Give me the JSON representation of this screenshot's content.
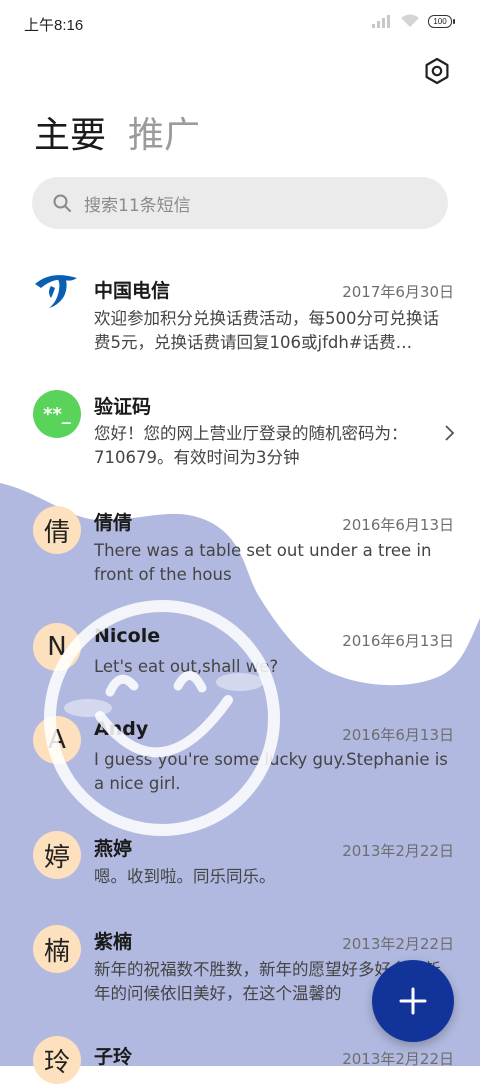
{
  "status_bar": {
    "time": "上午8:16",
    "battery": "100"
  },
  "tabs": [
    {
      "label": "主要"
    },
    {
      "label": "推广"
    }
  ],
  "search": {
    "placeholder": "搜索11条短信"
  },
  "messages": [
    {
      "name": "中国电信",
      "date": "2017年6月30日",
      "preview": "欢迎参加积分兑换话费活动，每500分可兑换话费5元，兑换话费请回复106或jfdh#话费…",
      "avatar": "china-telecom-logo"
    },
    {
      "name": "验证码",
      "date": "",
      "preview": "您好！您的网上营业厅登录的随机密码为：710679。有效时间为3分钟",
      "avatar_text": "**_"
    },
    {
      "name": "倩倩",
      "date": "2016年6月13日",
      "preview": "There was a table set out under a tree in front of the hous",
      "avatar_text": "倩"
    },
    {
      "name": "Nicole",
      "date": "2016年6月13日",
      "preview": "Let's eat out,shall we?",
      "avatar_text": "N"
    },
    {
      "name": "Andy",
      "date": "2016年6月13日",
      "preview": "I guess you're some lucky guy.Stephanie is a nice girl.",
      "avatar_text": "A"
    },
    {
      "name": "燕婷",
      "date": "2013年2月22日",
      "preview": "嗯。收到啦。同乐同乐。",
      "avatar_text": "婷"
    },
    {
      "name": "紫楠",
      "date": "2013年2月22日",
      "preview": "新年的祝福数不胜数，新年的愿望好多好多，新年的问候依旧美好，在这个温馨的",
      "avatar_text": "楠"
    },
    {
      "name": "子玲",
      "date": "2013年2月22日",
      "preview": "",
      "avatar_text": "玲"
    }
  ],
  "colors": {
    "wave": "#b1b9e0",
    "fab": "#12339a",
    "avatar": "#fde0bd",
    "green": "#5ad35a"
  }
}
